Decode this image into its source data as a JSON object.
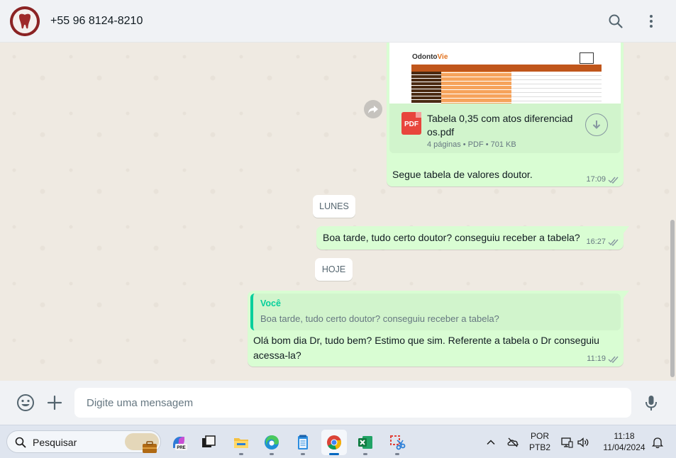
{
  "header": {
    "contact_name": "+55 96 8124-8210"
  },
  "messages": {
    "document": {
      "preview_logo_main": "Odonto",
      "preview_logo_accent": "Vie",
      "file_name": "Tabela 0,35 com atos diferenciados.pdf",
      "file_icon_label": "PDF",
      "file_info": "4 páginas • PDF • 701 KB",
      "caption": "Segue tabela de valores doutor.",
      "time": "17:09"
    },
    "date_chip_1": "LUNES",
    "message_1": {
      "text": "Boa tarde, tudo certo doutor? conseguiu receber a tabela?",
      "time": "16:27"
    },
    "date_chip_2": "HOJE",
    "message_2": {
      "quote_author": "Você",
      "quote_text": "Boa tarde, tudo certo doutor? conseguiu receber a tabela?",
      "text": "Olá bom dia Dr, tudo bem? Estimo que sim. Referente a tabela o Dr conseguiu acessa-la?",
      "time": "11:19"
    }
  },
  "footer": {
    "input_placeholder": "Digite uma mensagem"
  },
  "taskbar": {
    "search_label": "Pesquisar",
    "language_line1": "POR",
    "language_line2": "PTB2",
    "clock_time": "11:18",
    "clock_date": "11/04/2024",
    "copilot_badge": "PRE"
  },
  "colors": {
    "outgoing_bubble": "#d9fdd3",
    "chat_background": "#efeae2",
    "header_background": "#f0f2f5",
    "accent_green": "#06cf9c",
    "read_ticks": "#8696a0"
  }
}
